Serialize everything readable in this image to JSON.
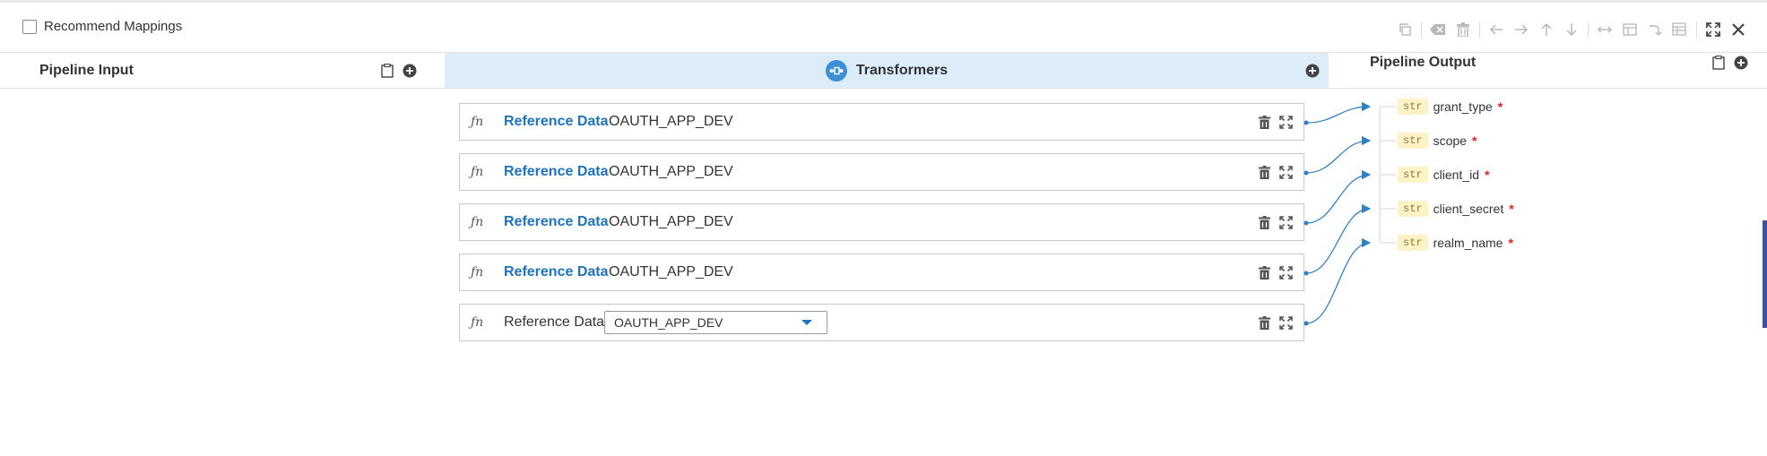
{
  "topbar": {
    "recommend_label": "Recommend Mappings",
    "toolbar_icons": [
      "copy-icon",
      "clear-icon",
      "delete-icon",
      "arrow-left-icon",
      "arrow-right-icon",
      "arrow-up-icon",
      "arrow-down-icon",
      "expand-horizontal-icon",
      "panel-icon",
      "redirect-icon",
      "table-icon",
      "fullscreen-icon",
      "close-icon"
    ]
  },
  "columns": {
    "input_title": "Pipeline Input",
    "transformers_title": "Transformers",
    "output_title": "Pipeline Output"
  },
  "transformers": [
    {
      "fn": "ƒn",
      "type": "Reference Data",
      "value": "OAUTH_APP_DEV"
    },
    {
      "fn": "ƒn",
      "type": "Reference Data",
      "value": "OAUTH_APP_DEV"
    },
    {
      "fn": "ƒn",
      "type": "Reference Data",
      "value": "OAUTH_APP_DEV"
    },
    {
      "fn": "ƒn",
      "type": "Reference Data",
      "value": "OAUTH_APP_DEV"
    },
    {
      "fn": "ƒn",
      "type": "Reference Data",
      "value": "OAUTH_APP_DEV"
    }
  ],
  "outputs": [
    {
      "type": "str",
      "name": "grant_type",
      "required": "*"
    },
    {
      "type": "str",
      "name": "scope",
      "required": "*"
    },
    {
      "type": "str",
      "name": "client_id",
      "required": "*"
    },
    {
      "type": "str",
      "name": "client_secret",
      "required": "*"
    },
    {
      "type": "str",
      "name": "realm_name",
      "required": "*"
    }
  ],
  "colors": {
    "accent": "#1e73be",
    "transformer_header_bg": "#dcecf9",
    "link_line": "#2f7fc6",
    "type_badge_bg": "#fdf3c4",
    "required": "#e02020"
  }
}
